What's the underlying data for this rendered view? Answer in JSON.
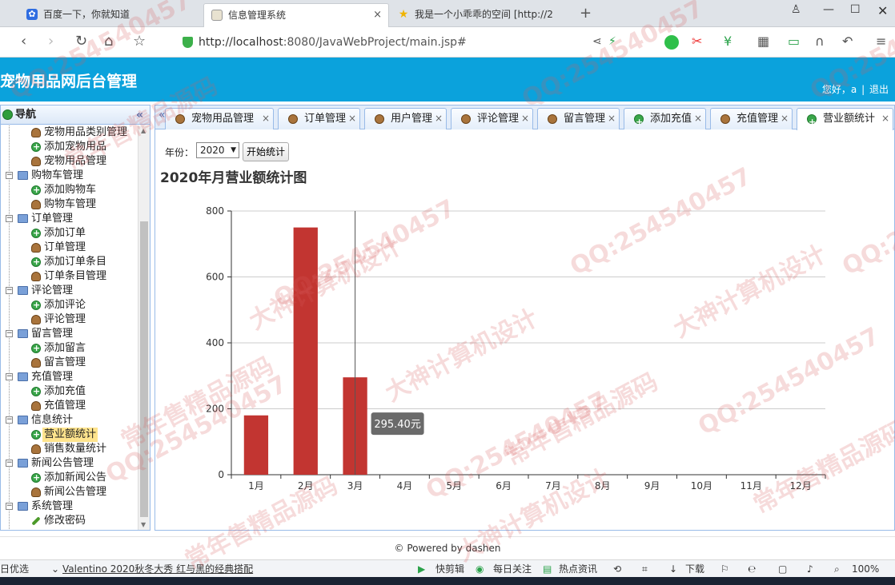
{
  "browser": {
    "tabs": [
      {
        "title": "百度一下，你就知道",
        "active": false
      },
      {
        "title": "信息管理系统",
        "active": true
      },
      {
        "title": "我是一个小乖乖的空间 [http://2",
        "active": false
      }
    ],
    "url_host": "http://localhost",
    "url_rest": ":8080/JavaWebProject/main.jsp#"
  },
  "header": {
    "title": "宠物用品网后台管理",
    "greeting": "您好，a",
    "separator": "|",
    "logout": "退出"
  },
  "sidebar": {
    "title": "导航",
    "collapse_icon": "«",
    "items": [
      {
        "label": "宠物用品类别管理",
        "type": "child",
        "icon": "user"
      },
      {
        "label": "添加宠物用品",
        "type": "child",
        "icon": "add"
      },
      {
        "label": "宠物用品管理",
        "type": "child",
        "icon": "user"
      },
      {
        "label": "购物车管理",
        "type": "group"
      },
      {
        "label": "添加购物车",
        "type": "child",
        "icon": "add"
      },
      {
        "label": "购物车管理",
        "type": "child",
        "icon": "user"
      },
      {
        "label": "订单管理",
        "type": "group"
      },
      {
        "label": "添加订单",
        "type": "child",
        "icon": "add"
      },
      {
        "label": "订单管理",
        "type": "child",
        "icon": "user"
      },
      {
        "label": "添加订单条目",
        "type": "child",
        "icon": "add"
      },
      {
        "label": "订单条目管理",
        "type": "child",
        "icon": "user"
      },
      {
        "label": "评论管理",
        "type": "group"
      },
      {
        "label": "添加评论",
        "type": "child",
        "icon": "add"
      },
      {
        "label": "评论管理",
        "type": "child",
        "icon": "user"
      },
      {
        "label": "留言管理",
        "type": "group"
      },
      {
        "label": "添加留言",
        "type": "child",
        "icon": "add"
      },
      {
        "label": "留言管理",
        "type": "child",
        "icon": "user"
      },
      {
        "label": "充值管理",
        "type": "group"
      },
      {
        "label": "添加充值",
        "type": "child",
        "icon": "add"
      },
      {
        "label": "充值管理",
        "type": "child",
        "icon": "user"
      },
      {
        "label": "信息统计",
        "type": "group"
      },
      {
        "label": "营业额统计",
        "type": "child",
        "icon": "add",
        "selected": true
      },
      {
        "label": "销售数量统计",
        "type": "child",
        "icon": "user"
      },
      {
        "label": "新闻公告管理",
        "type": "group"
      },
      {
        "label": "添加新闻公告",
        "type": "child",
        "icon": "add"
      },
      {
        "label": "新闻公告管理",
        "type": "child",
        "icon": "user"
      },
      {
        "label": "系统管理",
        "type": "group"
      },
      {
        "label": "修改密码",
        "type": "child",
        "icon": "pen"
      }
    ]
  },
  "content_tabs": [
    {
      "label": "宠物用品管理",
      "icon": "user"
    },
    {
      "label": "订单管理",
      "icon": "user"
    },
    {
      "label": "用户管理",
      "icon": "user"
    },
    {
      "label": "评论管理",
      "icon": "user"
    },
    {
      "label": "留言管理",
      "icon": "user"
    },
    {
      "label": "添加充值",
      "icon": "add"
    },
    {
      "label": "充值管理",
      "icon": "user"
    },
    {
      "label": "营业额统计",
      "icon": "add",
      "active": true
    }
  ],
  "toolbar": {
    "year_label": "年份：",
    "year_value": "2020",
    "start_button": "开始统计"
  },
  "chart_title": "2020年月营业额统计图",
  "chart_data": {
    "type": "bar",
    "title": "2020年月营业额统计图",
    "categories": [
      "1月",
      "2月",
      "3月",
      "4月",
      "5月",
      "6月",
      "7月",
      "8月",
      "9月",
      "10月",
      "11月",
      "12月"
    ],
    "values": [
      180,
      750,
      295.4,
      0,
      0,
      0,
      0,
      0,
      0,
      0,
      0,
      0
    ],
    "ylim": [
      0,
      800
    ],
    "yticks": [
      0,
      200,
      400,
      600,
      800
    ],
    "grid": true,
    "bar_color": "#c23531",
    "tooltip": {
      "category_index": 2,
      "text": "295.40元"
    }
  },
  "footer": "© Powered by dashen",
  "statusbar": {
    "left": "日优选",
    "news": "Valentino 2020秋冬大秀 红与黑的经典搭配",
    "items": [
      "快剪辑",
      "每日关注",
      "热点资讯",
      "下载"
    ],
    "zoom": "100%"
  },
  "watermark": {
    "texts": [
      "QQ:254540457",
      "常年售精品源码",
      "大神计算机设计"
    ]
  }
}
